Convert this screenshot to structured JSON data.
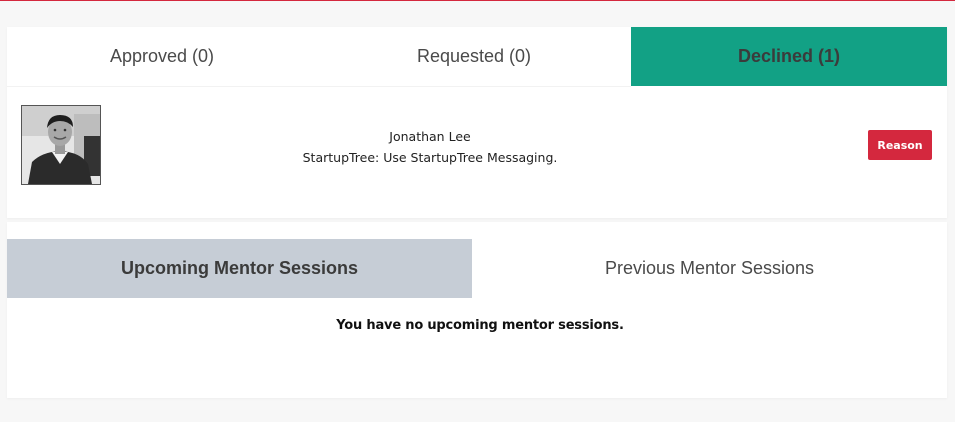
{
  "requests": {
    "tabs": {
      "approved": "Approved (0)",
      "requested": "Requested (0)",
      "declined": "Declined (1)"
    },
    "active_tab": "declined",
    "items": [
      {
        "name": "Jonathan Lee",
        "message": "StartupTree: Use StartupTree Messaging.",
        "action_label": "Reason"
      }
    ]
  },
  "sessions": {
    "tabs": {
      "upcoming": "Upcoming Mentor Sessions",
      "previous": "Previous Mentor Sessions"
    },
    "active_tab": "upcoming",
    "empty_message": "You have no upcoming mentor sessions."
  },
  "colors": {
    "declined_active": "#12a185",
    "upcoming_active": "#c6cdd6",
    "reason_button": "#d4283e",
    "top_line": "#d4283e"
  }
}
